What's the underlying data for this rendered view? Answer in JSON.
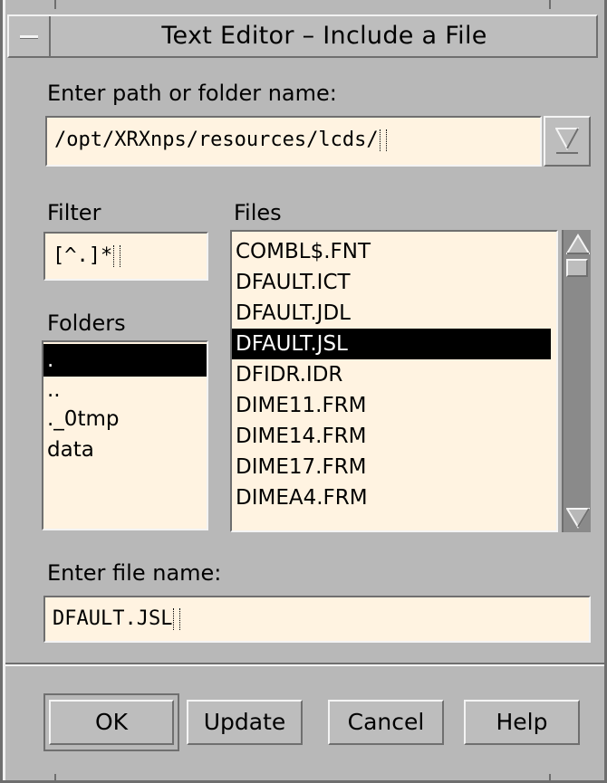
{
  "window": {
    "title": "Text Editor – Include a File"
  },
  "path": {
    "label": "Enter path or folder name:",
    "value": "/opt/XRXnps/resources/lcds/"
  },
  "filter": {
    "label": "Filter",
    "value": "[^.]*"
  },
  "folders": {
    "label": "Folders",
    "items": [
      ".",
      "..",
      "._0tmp",
      "data"
    ],
    "selected_index": 0
  },
  "files": {
    "label": "Files",
    "items": [
      "COMBL$.FNT",
      "DFAULT.ICT",
      "DFAULT.JDL",
      "DFAULT.JSL",
      "DFIDR.IDR",
      "DIME11.FRM",
      "DIME14.FRM",
      "DIME17.FRM",
      "DIMEA4.FRM"
    ],
    "selected_index": 3
  },
  "filename": {
    "label": "Enter file name:",
    "value": "DFAULT.JSL"
  },
  "buttons": {
    "ok": "OK",
    "update": "Update",
    "cancel": "Cancel",
    "help": "Help"
  },
  "colors": {
    "window_bg": "#b8b8b8",
    "field_bg": "#fff3e1",
    "selection_bg": "#000000"
  }
}
